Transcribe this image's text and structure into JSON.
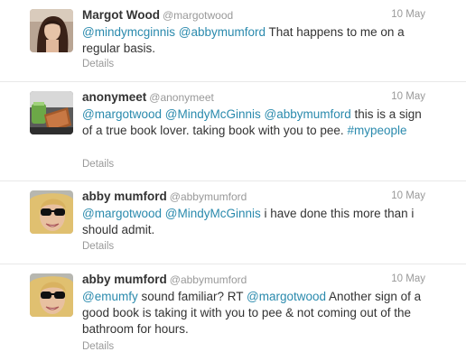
{
  "colors": {
    "link": "#2a8aad",
    "muted": "#999999",
    "text": "#333333",
    "divider": "#e8e8e8"
  },
  "tweets": [
    {
      "fullname": "Margot Wood",
      "username": "@margotwood",
      "time": "10 May",
      "details": "Details",
      "avatar": "profile-photo-margot",
      "mentions": [
        "@mindymcginnis",
        "@abbymumford"
      ],
      "text_after": " That happens to me on a regular basis."
    },
    {
      "fullname": "anonymeet",
      "username": "@anonymeet",
      "time": "10 May",
      "details": "Details",
      "avatar": "profile-photo-anonymeet",
      "mentions": [
        "@margotwood",
        "@MindyMcGinnis",
        "@abbymumford"
      ],
      "text_after": " this is a sign of a true book lover. taking book with you to pee. ",
      "hashtag": "#mypeople"
    },
    {
      "fullname": "abby mumford",
      "username": "@abbymumford",
      "time": "10 May",
      "details": "Details",
      "avatar": "profile-photo-abby",
      "mentions": [
        "@margotwood",
        "@MindyMcGinnis"
      ],
      "text_after": " i have done this more than i should admit."
    },
    {
      "fullname": "abby mumford",
      "username": "@abbymumford",
      "time": "10 May",
      "details": "Details",
      "avatar": "profile-photo-abby",
      "mention_1": "@emumfy",
      "text_mid": " sound familiar? RT ",
      "mention_2": "@margotwood",
      "text_after": " Another sign of a good book is taking it with you to pee & not coming out of the bathroom for hours."
    }
  ]
}
